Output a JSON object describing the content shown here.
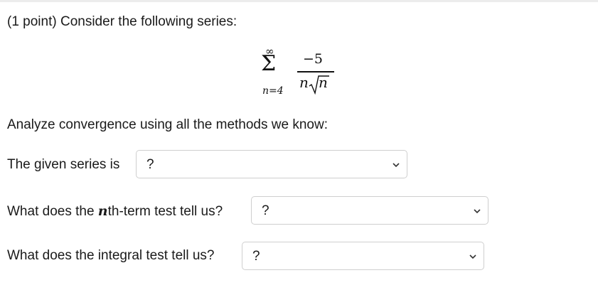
{
  "question": {
    "intro": "(1 point) Consider the following series:",
    "series": {
      "upper_limit": "∞",
      "sigma": "Σ",
      "lower_limit": "n=4",
      "numerator": "−5",
      "denominator_n": "n",
      "denominator_radicand": "n"
    },
    "analyze_text": "Analyze convergence using all the methods we know:"
  },
  "q1": {
    "label": "The given series is",
    "selected": "?",
    "icon": "chevron-down-icon"
  },
  "q2": {
    "label_before": "What does the ",
    "label_var": "n",
    "label_after": "th-term test tell us?",
    "selected": "?",
    "icon": "chevron-down-icon"
  },
  "q3": {
    "label": "What does the integral test tell us?",
    "selected": "?",
    "icon": "chevron-down-icon"
  }
}
